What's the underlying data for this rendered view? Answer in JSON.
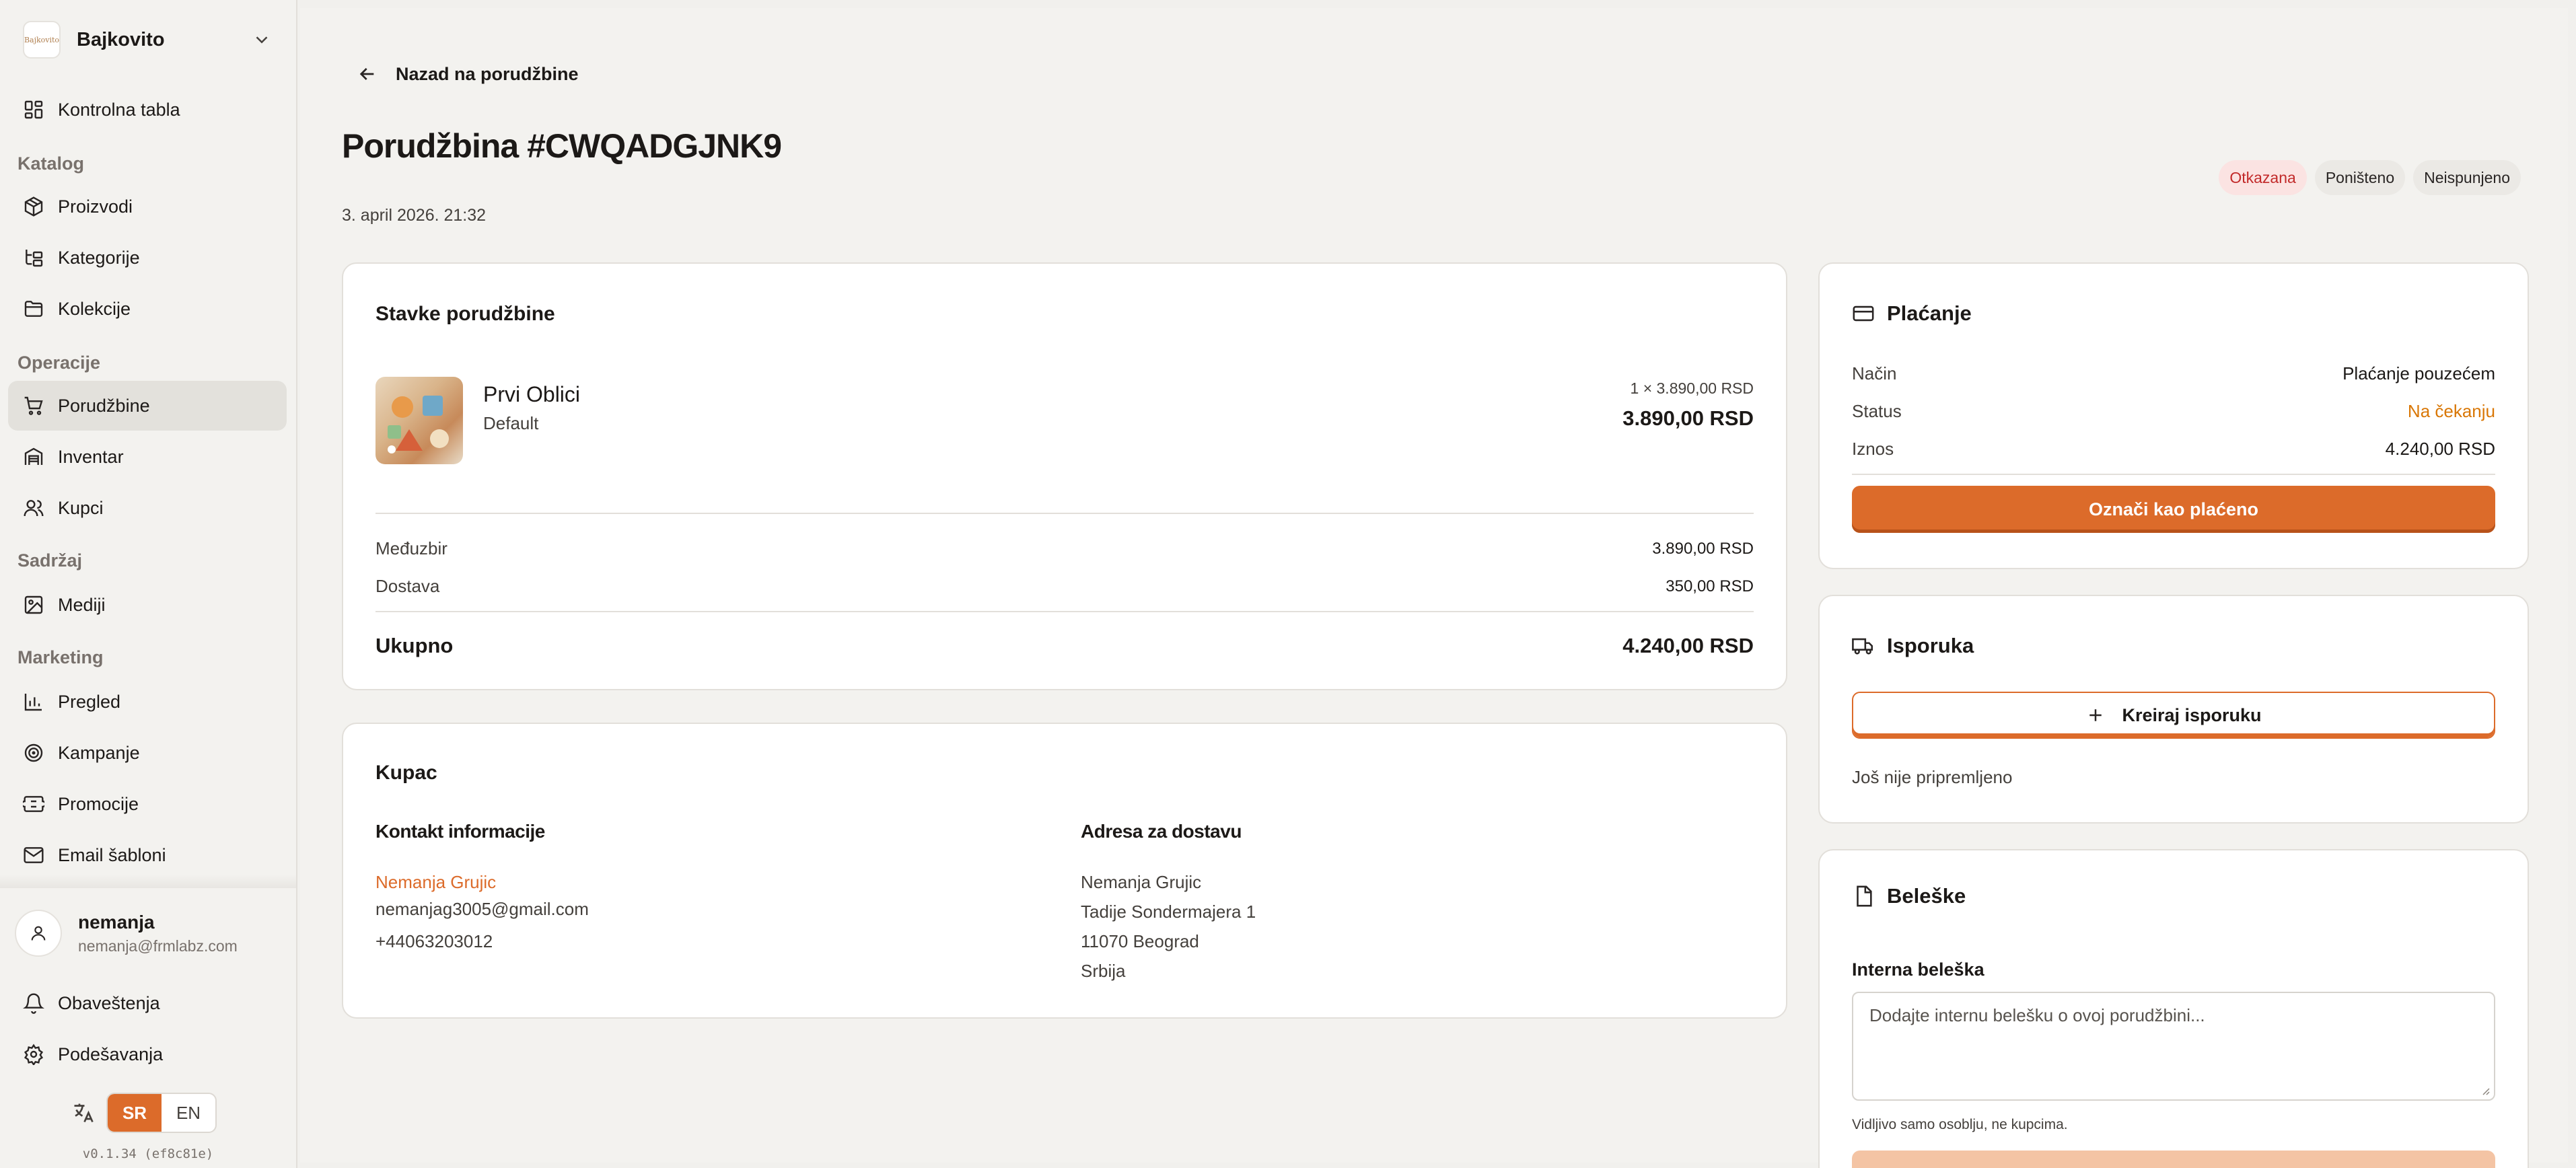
{
  "sidebar": {
    "store_name": "Bajkovito",
    "logo_text": "Bajkovito",
    "items": {
      "dashboard": "Kontrolna tabla",
      "products": "Proizvodi",
      "categories": "Kategorije",
      "collections": "Kolekcije",
      "orders": "Porudžbine",
      "inventory": "Inventar",
      "customers": "Kupci",
      "media": "Mediji",
      "overview": "Pregled",
      "campaigns": "Kampanje",
      "promotions": "Promocije",
      "email_templates": "Email šabloni",
      "notifications": "Obaveštenja",
      "settings": "Podešavanja"
    },
    "sections": {
      "catalog": "Katalog",
      "operations": "Operacije",
      "content": "Sadržaj",
      "marketing": "Marketing"
    },
    "user": {
      "name": "nemanja",
      "email": "nemanja@frmlabz.com"
    },
    "languages": {
      "sr": "SR",
      "en": "EN",
      "active": "SR"
    },
    "version": "v0.1.34 (ef8c81e)"
  },
  "header": {
    "back_label": "Nazad na porudžbine",
    "title": "Porudžbina #CWQADGJNK9",
    "date": "3. april 2026. 21:32",
    "badges": {
      "status": "Otkazana",
      "payment": "Poništeno",
      "fulfillment": "Neispunjeno"
    }
  },
  "items_card": {
    "title": "Stavke porudžbine",
    "items": [
      {
        "name": "Prvi Oblici",
        "variant": "Default",
        "qty_price": "1 × 3.890,00 RSD",
        "total": "3.890,00 RSD"
      }
    ],
    "subtotal_label": "Međuzbir",
    "subtotal_value": "3.890,00 RSD",
    "shipping_label": "Dostava",
    "shipping_value": "350,00 RSD",
    "total_label": "Ukupno",
    "total_value": "4.240,00 RSD"
  },
  "customer_card": {
    "title": "Kupac",
    "contact_heading": "Kontakt informacije",
    "contact_name": "Nemanja Grujic",
    "contact_email": "nemanjag3005@gmail.com",
    "contact_phone": "+44063203012",
    "address_heading": "Adresa za dostavu",
    "address_lines": [
      "Nemanja Grujic",
      "Tadije Sondermajera 1",
      "11070 Beograd",
      "Srbija"
    ]
  },
  "payment_card": {
    "title": "Plaćanje",
    "method_label": "Način",
    "method_value": "Plaćanje pouzećem",
    "status_label": "Status",
    "status_value": "Na čekanju",
    "amount_label": "Iznos",
    "amount_value": "4.240,00 RSD",
    "mark_paid_button": "Označi kao plaćeno"
  },
  "shipping_card": {
    "title": "Isporuka",
    "create_button": "Kreiraj isporuku",
    "status_text": "Još nije pripremljeno"
  },
  "notes_card": {
    "title": "Beleške",
    "internal_label": "Interna beleška",
    "placeholder": "Dodajte internu belešku o ovoj porudžbini...",
    "hint": "Vidljivo samo osoblju, ne kupcima."
  },
  "colors": {
    "accent": "#dc6b2a",
    "danger": "#c22a2a",
    "warning": "#d97706",
    "background": "#f3f2ef"
  },
  "icons": {
    "dashboard": "grid-icon",
    "products": "package-icon",
    "categories": "tree-icon",
    "collections": "folder-icon",
    "orders": "cart-icon",
    "inventory": "warehouse-icon",
    "customers": "users-icon",
    "media": "image-icon",
    "overview": "bar-chart-icon",
    "campaigns": "target-icon",
    "promotions": "ticket-icon",
    "email_templates": "mail-icon",
    "notifications": "bell-icon",
    "settings": "gear-icon",
    "language": "translate-icon"
  }
}
